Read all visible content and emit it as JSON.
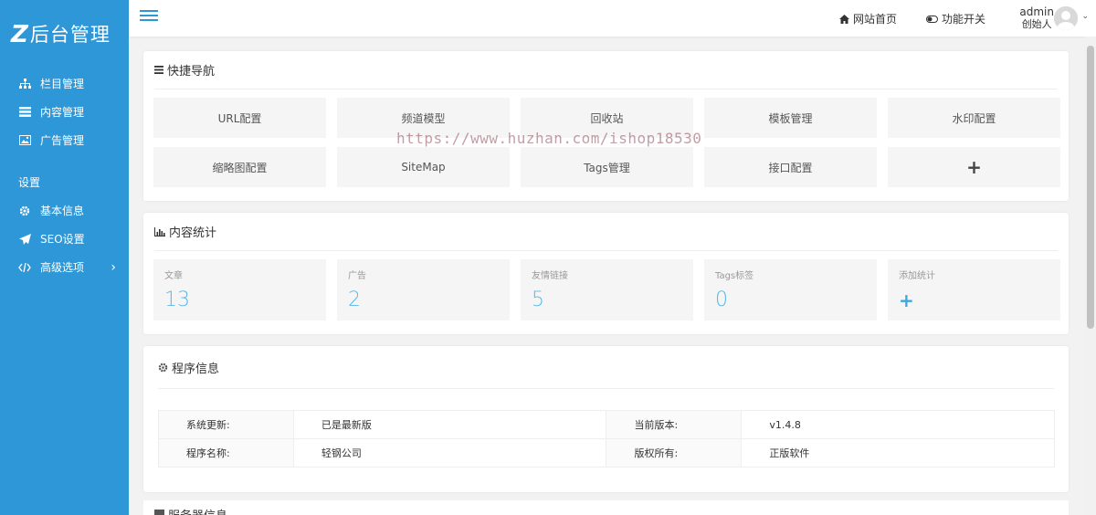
{
  "sidebar": {
    "logo_mark": "Z",
    "logo_text": "后台管理",
    "items": [
      {
        "label": "栏目管理"
      },
      {
        "label": "内容管理"
      },
      {
        "label": "广告管理"
      }
    ],
    "group_title": "设置",
    "settings": [
      {
        "label": "基本信息"
      },
      {
        "label": "SEO设置"
      },
      {
        "label": "高级选项"
      }
    ],
    "bg_color": "#2e97d8"
  },
  "topbar": {
    "site_home": "网站首页",
    "feature_switch": "功能开关",
    "username": "admin",
    "role": "创始人"
  },
  "quick_nav": {
    "title": "快捷导航",
    "items": [
      {
        "label": "URL配置"
      },
      {
        "label": "频道模型"
      },
      {
        "label": "回收站"
      },
      {
        "label": "模板管理"
      },
      {
        "label": "水印配置"
      },
      {
        "label": "缩略图配置"
      },
      {
        "label": "SiteMap"
      },
      {
        "label": "Tags管理"
      },
      {
        "label": "接口配置"
      },
      {
        "label": "+"
      }
    ]
  },
  "stats": {
    "title": "内容统计",
    "items": [
      {
        "label": "文章",
        "value": "13"
      },
      {
        "label": "广告",
        "value": "2"
      },
      {
        "label": "友情链接",
        "value": "5"
      },
      {
        "label": "Tags标签",
        "value": "0"
      },
      {
        "label": "添加统计",
        "value": "+"
      }
    ]
  },
  "program_info": {
    "title": "程序信息",
    "rows": [
      {
        "l1": "系统更新:",
        "v1": "已是最新版",
        "l2": "当前版本:",
        "v2": "v1.4.8"
      },
      {
        "l1": "程序名称:",
        "v1": "轻钢公司",
        "l2": "版权所有:",
        "v2": "正版软件"
      }
    ]
  },
  "server_info": {
    "title": "服务器信息"
  },
  "watermark": "https://www.huzhan.com/ishop18530"
}
